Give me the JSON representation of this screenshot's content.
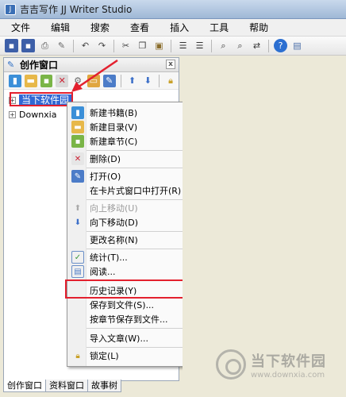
{
  "window": {
    "title": "吉吉写作 JJ Writer Studio"
  },
  "menu": [
    {
      "label": "文件"
    },
    {
      "label": "编辑"
    },
    {
      "label": "搜索"
    },
    {
      "label": "查看"
    },
    {
      "label": "插入"
    },
    {
      "label": "工具"
    },
    {
      "label": "帮助"
    }
  ],
  "panel": {
    "title": "创作窗口",
    "close_glyph": "x"
  },
  "tree": [
    {
      "label": "当下软件园",
      "expander": "+",
      "selected": true
    },
    {
      "label": "Downxia",
      "expander": "+",
      "selected": false
    }
  ],
  "context_menu": [
    {
      "label": "新建书籍(B)",
      "icon": "book-icon",
      "disabled": false
    },
    {
      "label": "新建目录(V)",
      "icon": "folder-icon",
      "disabled": false
    },
    {
      "label": "新建章节(C)",
      "icon": "chapter-icon",
      "disabled": false
    },
    {
      "label": "删除(D)",
      "icon": "delete-icon",
      "disabled": false
    },
    {
      "label": "打开(O)",
      "icon": "open-icon",
      "disabled": false
    },
    {
      "label": "在卡片式窗口中打开(R)",
      "icon": "",
      "disabled": false
    },
    {
      "label": "向上移动(U)",
      "icon": "arrow-up-icon",
      "disabled": true
    },
    {
      "label": "向下移动(D)",
      "icon": "arrow-down-icon",
      "disabled": false
    },
    {
      "label": "更改名称(N)",
      "icon": "",
      "disabled": false
    },
    {
      "label": "统计(T)...",
      "icon": "stats-icon",
      "disabled": false
    },
    {
      "label": "阅读...",
      "icon": "read-icon",
      "disabled": false
    },
    {
      "label": "历史记录(Y)",
      "icon": "",
      "disabled": false
    },
    {
      "label": "保存到文件(S)...",
      "icon": "",
      "disabled": false
    },
    {
      "label": "按章节保存到文件...",
      "icon": "",
      "disabled": false
    },
    {
      "label": "导入文章(W)...",
      "icon": "",
      "disabled": false
    },
    {
      "label": "锁定(L)",
      "icon": "lock-icon",
      "disabled": false
    }
  ],
  "tabs": [
    {
      "label": "创作窗口",
      "active": true
    },
    {
      "label": "资料窗口",
      "active": false
    },
    {
      "label": "故事树",
      "active": false
    }
  ],
  "watermark": {
    "name": "当下软件园",
    "url": "www.downxia.com"
  },
  "colors": {
    "selection": "#3168d4",
    "highlight": "#e3202e"
  }
}
